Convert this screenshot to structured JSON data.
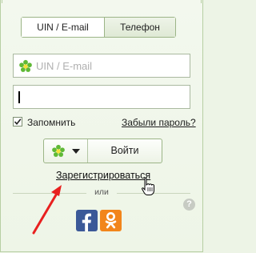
{
  "tabs": [
    {
      "label": "UIN / E-mail",
      "active": true
    },
    {
      "label": "Телефон",
      "active": false
    }
  ],
  "login_form": {
    "uin_placeholder": "UIN / E-mail",
    "uin_icon": "icq-flower-icon",
    "password_value": "",
    "remember_label": "Запомнить",
    "remember_checked": true,
    "forgot_label": "Забыли пароль?",
    "login_label": "Войти",
    "account_picker_icon": "icq-flower-icon",
    "register_label": "Зарегистрироваться"
  },
  "alt_login": {
    "or_label": "или",
    "help_label": "?",
    "social_buttons": [
      {
        "name": "facebook",
        "icon": "facebook-icon",
        "color": "#3b5998"
      },
      {
        "name": "odnoklassniki",
        "icon": "odnoklassniki-icon",
        "color": "#f2851b"
      }
    ]
  },
  "colors": {
    "accent_green": "#5fb936",
    "annotation_arrow": "#e8201f"
  }
}
